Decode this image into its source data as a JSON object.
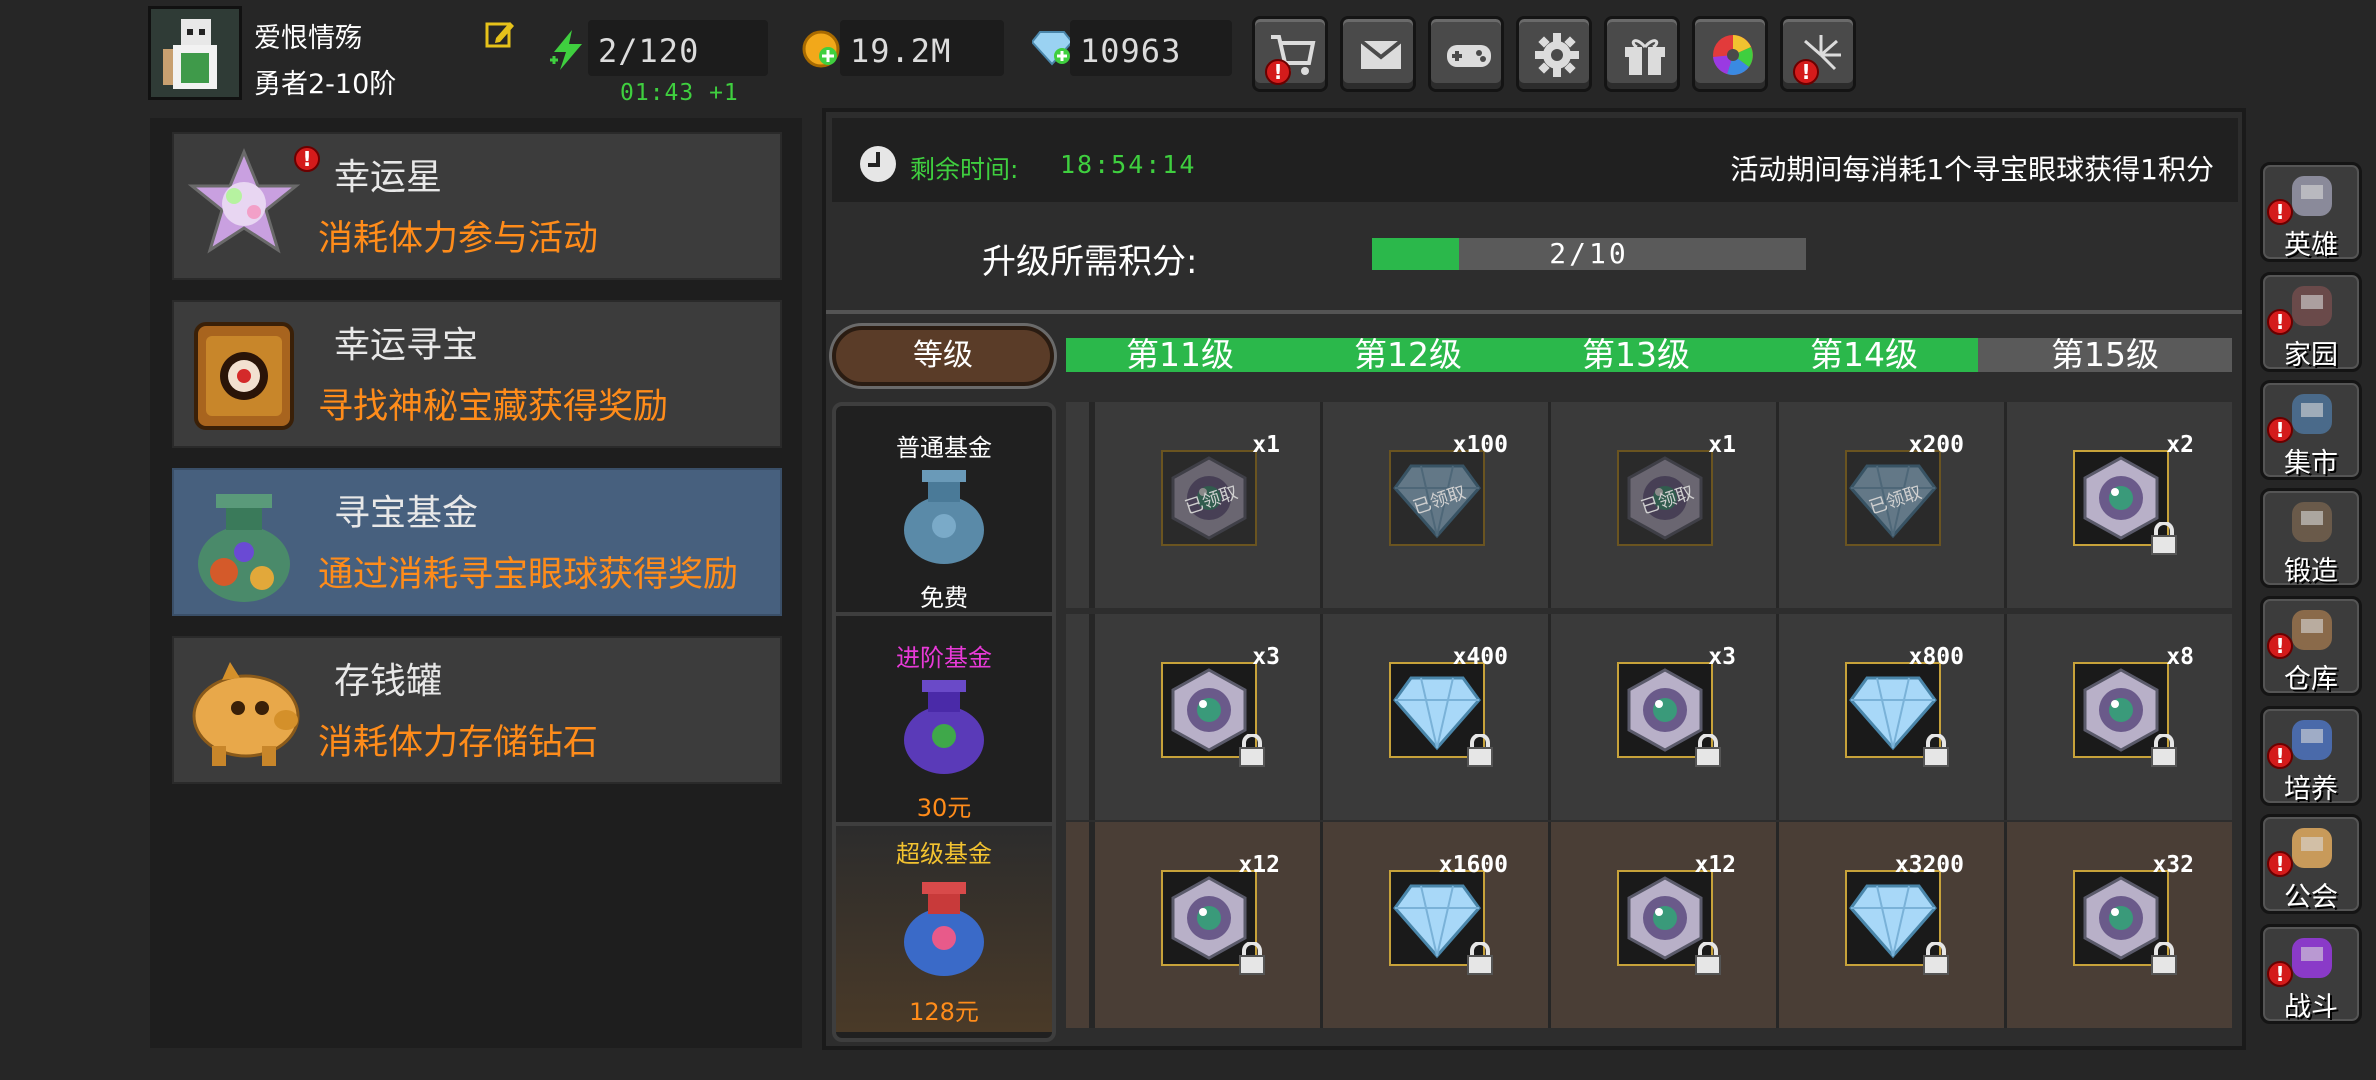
{
  "player": {
    "name": "爱恨情殇",
    "rank": "勇者2-10阶",
    "stamina": "2/120",
    "stamina_timer": "01:43 +1",
    "gold": "19.2M",
    "diamonds": "10963"
  },
  "toolbar": {
    "buttons": [
      {
        "icon": "shop-cart-icon",
        "alert": true
      },
      {
        "icon": "mail-icon",
        "alert": false
      },
      {
        "icon": "gamepad-icon",
        "alert": false
      },
      {
        "icon": "gear-icon",
        "alert": false
      },
      {
        "icon": "gift-icon",
        "alert": false
      },
      {
        "icon": "color-wheel-icon",
        "alert": false
      },
      {
        "icon": "firework-icon",
        "alert": true
      }
    ]
  },
  "menu": {
    "items": [
      {
        "title": "幸运星",
        "desc": "消耗体力参与活动",
        "icon": "lucky-star-icon",
        "alert": true,
        "active": false
      },
      {
        "title": "幸运寻宝",
        "desc": "寻找神秘宝藏获得奖励",
        "icon": "treasure-chest-icon",
        "alert": false,
        "active": false
      },
      {
        "title": "寻宝基金",
        "desc": "通过消耗寻宝眼球获得奖励",
        "icon": "money-bag-icon",
        "alert": false,
        "active": true
      },
      {
        "title": "存钱罐",
        "desc": "消耗体力存储钻石",
        "icon": "piggy-bank-icon",
        "alert": false,
        "active": false
      }
    ]
  },
  "fund": {
    "remaining_label": "剩余时间:",
    "remaining_time": "18:54:14",
    "note": "活动期间每消耗1个寻宝眼球获得1积分",
    "upgrade_label": "升级所需积分:",
    "progress_text": "2/10",
    "progress_fraction": 0.2,
    "level_header": "等级",
    "levels": [
      "第11级",
      "第12级",
      "第13级",
      "第14级",
      "第15级"
    ],
    "locked_level_index": 4,
    "tiers": [
      {
        "name": "普通基金",
        "price": "免费",
        "name_color": "#ffffff",
        "price_color": "#ffffff"
      },
      {
        "name": "进阶基金",
        "price": "30元",
        "name_color": "#e83ad8",
        "price_color": "#ff8c1a"
      },
      {
        "name": "超级基金",
        "price": "128元",
        "name_color": "#f2c230",
        "price_color": "#ff8c1a"
      }
    ],
    "claimed_text": "已领取",
    "rewards": [
      [
        {
          "item": "eyeball-icon",
          "qty": "x1",
          "claimed": true,
          "locked": false
        },
        {
          "item": "diamond-icon",
          "qty": "x100",
          "claimed": true,
          "locked": false
        },
        {
          "item": "eyeball-icon",
          "qty": "x1",
          "claimed": true,
          "locked": false
        },
        {
          "item": "diamond-icon",
          "qty": "x200",
          "claimed": true,
          "locked": false
        },
        {
          "item": "eyeball-icon",
          "qty": "x2",
          "claimed": false,
          "locked": true
        }
      ],
      [
        {
          "item": "eyeball-icon",
          "qty": "x3",
          "claimed": false,
          "locked": true
        },
        {
          "item": "diamond-icon",
          "qty": "x400",
          "claimed": false,
          "locked": true
        },
        {
          "item": "eyeball-icon",
          "qty": "x3",
          "claimed": false,
          "locked": true
        },
        {
          "item": "diamond-icon",
          "qty": "x800",
          "claimed": false,
          "locked": true
        },
        {
          "item": "eyeball-icon",
          "qty": "x8",
          "claimed": false,
          "locked": true
        }
      ],
      [
        {
          "item": "eyeball-icon",
          "qty": "x12",
          "claimed": false,
          "locked": true
        },
        {
          "item": "diamond-icon",
          "qty": "x1600",
          "claimed": false,
          "locked": true
        },
        {
          "item": "eyeball-icon",
          "qty": "x12",
          "claimed": false,
          "locked": true
        },
        {
          "item": "diamond-icon",
          "qty": "x3200",
          "claimed": false,
          "locked": true
        },
        {
          "item": "eyeball-icon",
          "qty": "x32",
          "claimed": false,
          "locked": true
        }
      ]
    ]
  },
  "sidebar": {
    "items": [
      {
        "label": "英雄",
        "icon": "hero-helmet-icon",
        "alert": true
      },
      {
        "label": "家园",
        "icon": "castle-icon",
        "alert": true
      },
      {
        "label": "集市",
        "icon": "market-icon",
        "alert": true
      },
      {
        "label": "锻造",
        "icon": "anvil-icon",
        "alert": false
      },
      {
        "label": "仓库",
        "icon": "warehouse-icon",
        "alert": true
      },
      {
        "label": "培养",
        "icon": "chalice-icon",
        "alert": true
      },
      {
        "label": "公会",
        "icon": "guild-lion-icon",
        "alert": true
      },
      {
        "label": "战斗",
        "icon": "battle-portal-icon",
        "alert": true
      }
    ]
  }
}
